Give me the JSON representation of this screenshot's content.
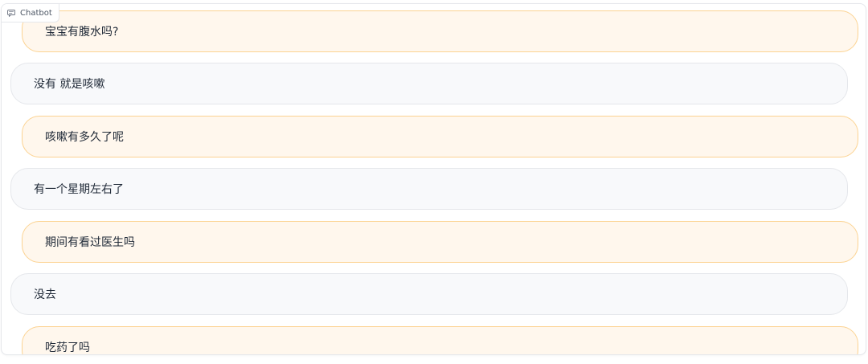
{
  "component": {
    "label": "Chatbot",
    "icon": "chat-icon"
  },
  "colors": {
    "user_bubble_bg": "#fff7ed",
    "user_bubble_border": "#fcd392",
    "bot_bubble_bg": "#f8f9fb",
    "bot_bubble_border": "#e5e7eb"
  },
  "messages": [
    {
      "role": "user",
      "text": "宝宝有腹水吗?"
    },
    {
      "role": "bot",
      "text": "没有 就是咳嗽"
    },
    {
      "role": "user",
      "text": "咳嗽有多久了呢"
    },
    {
      "role": "bot",
      "text": "有一个星期左右了"
    },
    {
      "role": "user",
      "text": "期间有看过医生吗"
    },
    {
      "role": "bot",
      "text": "没去"
    },
    {
      "role": "user",
      "text": "吃药了吗"
    }
  ]
}
